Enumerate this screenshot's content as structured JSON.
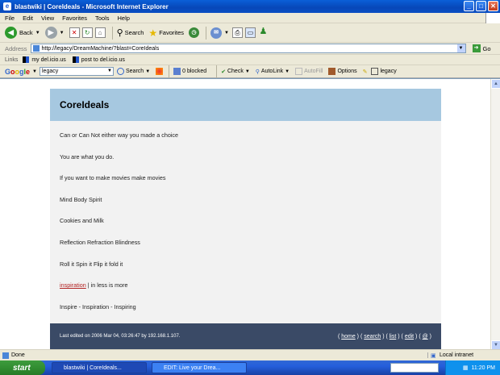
{
  "window": {
    "title": "blastwiki | CoreIdeals - Microsoft Internet Explorer"
  },
  "menu": [
    "File",
    "Edit",
    "View",
    "Favorites",
    "Tools",
    "Help"
  ],
  "toolbar": {
    "back": "Back",
    "search": "Search",
    "favorites": "Favorites"
  },
  "address": {
    "label": "Address",
    "url": "http://legacy/DreamMachine/?blast=CoreIdeals",
    "go": "Go"
  },
  "links": {
    "label": "Links",
    "items": [
      "my del.icio.us",
      "post to del.icio.us"
    ]
  },
  "google": {
    "logo": "Google",
    "query": "legacy",
    "search": "Search",
    "blocked": "0 blocked",
    "check": "Check",
    "autolink": "AutoLink",
    "autofill": "AutoFill",
    "options": "Options",
    "highlight": "legacy"
  },
  "page": {
    "title": "CoreIdeals",
    "lines": [
      "Can or Can Not either way you made a choice",
      "You are what you do.",
      "If you want to make movies make movies",
      "Mind Body Spirit",
      "Cookies and Milk",
      "Reflection Refraction Blindness",
      "Roll it Spin it Flip it fold it"
    ],
    "inspiration_link": "inspiration",
    "inspiration_rest": " | in less is more",
    "last_line": "Inspire - Inspiration - Inspiring",
    "footer_text": "Last edited on 2006 Mar 04, 03:26:47 by 192.168.1.107.",
    "footer_links": {
      "home": "home",
      "search": "search",
      "list": "list",
      "edit": "edit",
      "help": "@"
    }
  },
  "status": {
    "text": "Done",
    "zone": "Local intranet"
  },
  "taskbar": {
    "start": "start",
    "tasks": [
      "blastwiki | CoreIdeals...",
      "EDIT: Live your Drea..."
    ],
    "time": "11:20 PM"
  }
}
